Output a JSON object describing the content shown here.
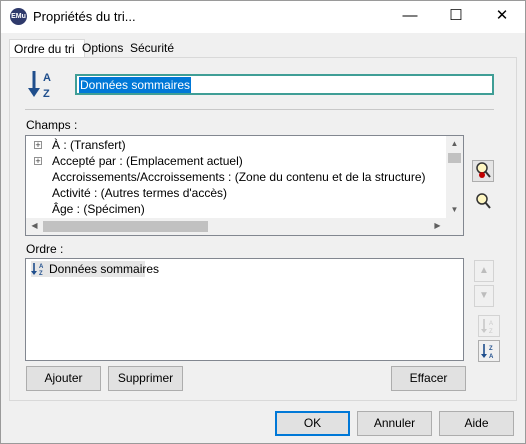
{
  "window": {
    "title": "Propriétés du tri...",
    "icon_text": "EMu",
    "minimize_glyph": "—",
    "maximize_glyph": "☐",
    "close_glyph": "✕"
  },
  "tabs": [
    {
      "label": "Ordre du tri",
      "active": true
    },
    {
      "label": "Options",
      "active": false
    },
    {
      "label": "Sécurité",
      "active": false
    }
  ],
  "sort_name": {
    "value": "Données sommaires"
  },
  "champs": {
    "label": "Champs :",
    "items": [
      {
        "text": "À : (Transfert)",
        "expandable": true
      },
      {
        "text": "Accepté par : (Emplacement actuel)",
        "expandable": true
      },
      {
        "text": "Accroissements/Accroissements : (Zone du contenu et de la structure)",
        "expandable": false
      },
      {
        "text": "Activité : (Autres termes d'accès)",
        "expandable": false
      },
      {
        "text": "Âge : (Spécimen)",
        "expandable": false
      }
    ]
  },
  "ordre": {
    "label": "Ordre :",
    "items": [
      {
        "text": "Données sommaires"
      }
    ]
  },
  "buttons": {
    "ajouter": "Ajouter",
    "supprimer": "Supprimer",
    "effacer": "Effacer",
    "ok": "OK",
    "annuler": "Annuler",
    "aide": "Aide"
  },
  "colors": {
    "accent": "#0078d7",
    "sort_blue": "#1f4e8c",
    "focus_teal": "#3f9e96"
  }
}
